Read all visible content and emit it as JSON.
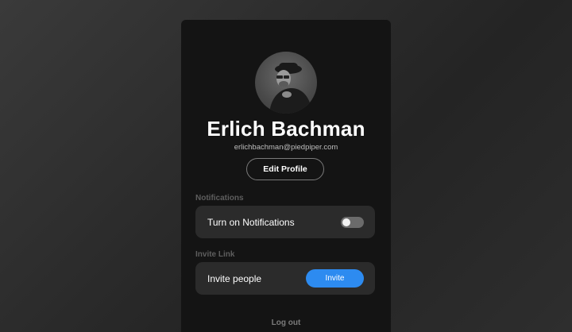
{
  "profile": {
    "name": "Erlich Bachman",
    "email": "erlichbachman@piedpiper.com",
    "edit_label": "Edit Profile",
    "avatar_icon": "person-silhouette-icon"
  },
  "notifications": {
    "section_label": "Notifications",
    "row_label": "Turn on Notifications",
    "enabled": false
  },
  "invite": {
    "section_label": "Invite Link",
    "row_label": "Invite people",
    "button_label": "Invite",
    "button_color": "#2d8bf0"
  },
  "footer": {
    "logout_label": "Log out"
  }
}
